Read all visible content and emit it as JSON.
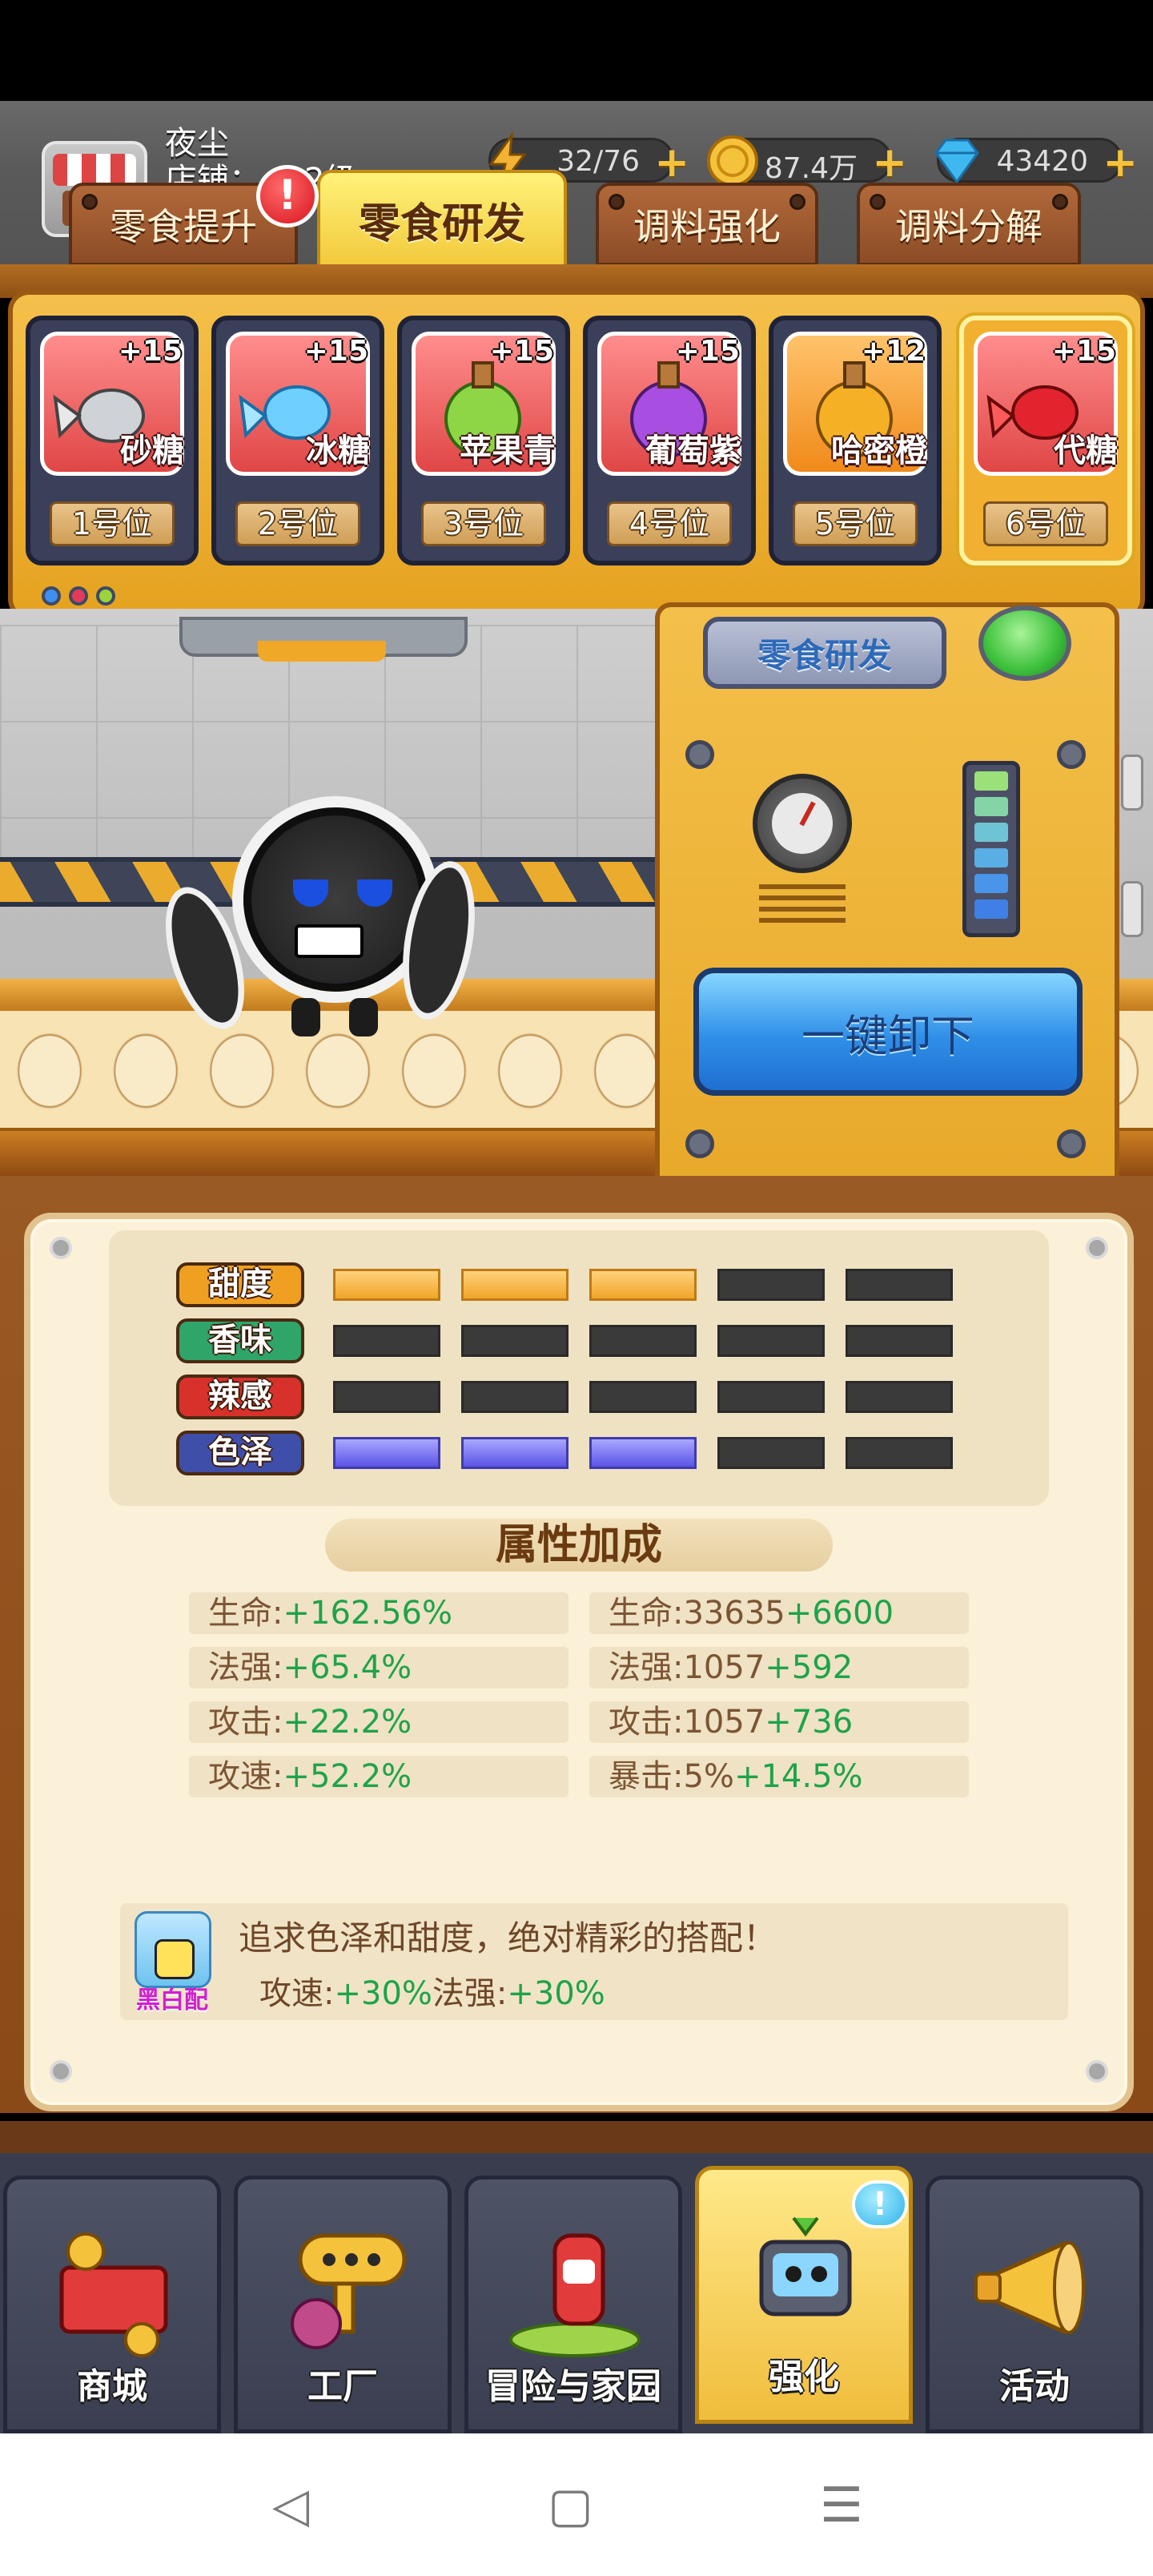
{
  "player": {
    "name": "夜尘",
    "shop_label": "店铺：",
    "shop_level": "2级"
  },
  "resources": {
    "energy": {
      "value": "32/76",
      "icon": "lightning-icon"
    },
    "coins": {
      "value": "87.4万",
      "icon": "coin-icon"
    },
    "gems": {
      "value": "43420",
      "icon": "diamond-icon"
    },
    "plus": "+"
  },
  "tabs": [
    {
      "label": "零食提升"
    },
    {
      "label": "零食研发"
    },
    {
      "label": "调料强化"
    },
    {
      "label": "调料分解"
    }
  ],
  "alert_badge": "!",
  "slots": [
    {
      "name": "砂糖",
      "level": "+15",
      "position": "1号位"
    },
    {
      "name": "冰糖",
      "level": "+15",
      "position": "2号位"
    },
    {
      "name": "苹果青",
      "level": "+15",
      "position": "3号位"
    },
    {
      "name": "葡萄紫",
      "level": "+15",
      "position": "4号位"
    },
    {
      "name": "哈密橙",
      "level": "+12",
      "position": "5号位"
    },
    {
      "name": "代糖",
      "level": "+15",
      "position": "6号位"
    }
  ],
  "machine": {
    "sign": "零食研发",
    "unload_button": "一键卸下"
  },
  "meters": [
    {
      "label": "甜度",
      "filled": 3,
      "total": 5,
      "color": "#f0a52a",
      "label_color": "#f0a020"
    },
    {
      "label": "香味",
      "filled": 0,
      "total": 5,
      "color": "#3a3a3a",
      "label_color": "#2fa56a"
    },
    {
      "label": "辣感",
      "filled": 0,
      "total": 5,
      "color": "#3a3a3a",
      "label_color": "#d8312c"
    },
    {
      "label": "色泽",
      "filled": 3,
      "total": 5,
      "color": "#5a53e6",
      "label_color": "#3f4ea8"
    }
  ],
  "attributes": {
    "title": "属性加成",
    "left": [
      {
        "key": "生命:",
        "val": "+162.56%"
      },
      {
        "key": "法强:",
        "val": "+65.4%"
      },
      {
        "key": "攻击:",
        "val": "+22.2%"
      },
      {
        "key": "攻速:",
        "val": "+52.2%"
      }
    ],
    "right": [
      {
        "key": "生命:33635",
        "val": "+6600"
      },
      {
        "key": "法强:1057",
        "val": "+592"
      },
      {
        "key": "攻击:1057",
        "val": "+736"
      },
      {
        "key": "暴击:5%",
        "val": "+14.5%"
      }
    ]
  },
  "combo": {
    "tag": "黑白配",
    "desc": "追求色泽和甜度，绝对精彩的搭配！",
    "eff1_key": "攻速:",
    "eff1_val": "+30%",
    "eff2_key": "法强:",
    "eff2_val": "+30%"
  },
  "nav": [
    {
      "label": "商城",
      "icon": "shop-cart-icon"
    },
    {
      "label": "工厂",
      "icon": "factory-icon"
    },
    {
      "label": "冒险与家园",
      "icon": "adventure-icon"
    },
    {
      "label": "强化",
      "icon": "robot-icon"
    },
    {
      "label": "活动",
      "icon": "megaphone-icon"
    }
  ],
  "nav_badge": "!",
  "system_nav": {
    "back": "◁",
    "home": "▢",
    "menu": "☰"
  }
}
